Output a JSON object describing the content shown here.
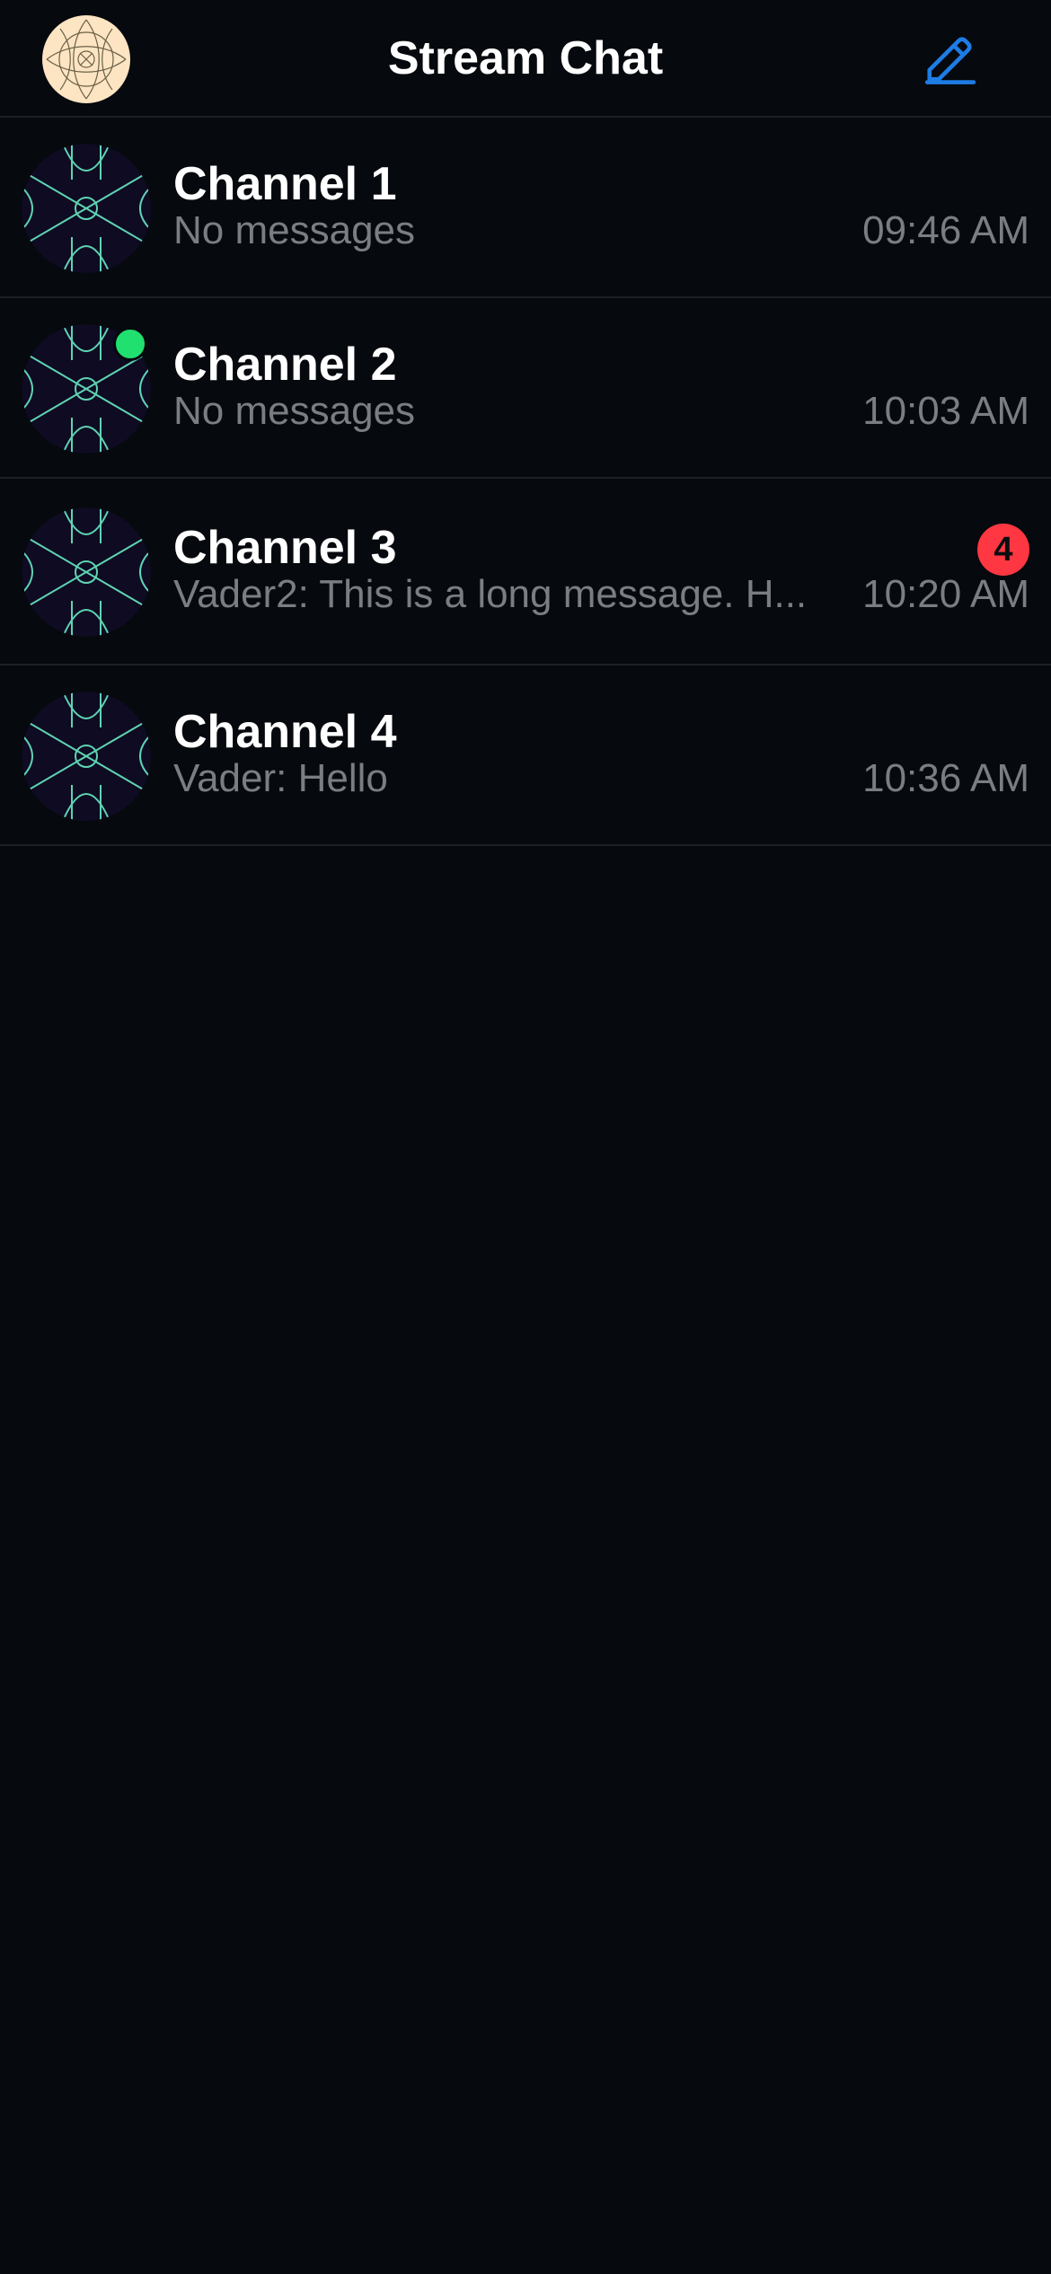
{
  "header": {
    "title": "Stream Chat",
    "user_avatar_icon": "user-avatar-pattern",
    "compose_icon": "pencil-icon",
    "accent_color": "#1d7ce5"
  },
  "channels": [
    {
      "name": "Channel 1",
      "preview": "No messages",
      "time": "09:46 AM",
      "online": false,
      "unread": null
    },
    {
      "name": "Channel 2",
      "preview": "No messages",
      "time": "10:03 AM",
      "online": true,
      "unread": null
    },
    {
      "name": "Channel 3",
      "preview": "Vader2: This is a long message. H...",
      "time": "10:20 AM",
      "online": false,
      "unread": "4"
    },
    {
      "name": "Channel 4",
      "preview": "Vader: Hello",
      "time": "10:36 AM",
      "online": false,
      "unread": null
    }
  ],
  "colors": {
    "background": "#06090d",
    "online": "#20e070",
    "unread_badge": "#ff3742",
    "avatar_lines": "#5fd3b3",
    "avatar_bg": "#0e0b22"
  }
}
